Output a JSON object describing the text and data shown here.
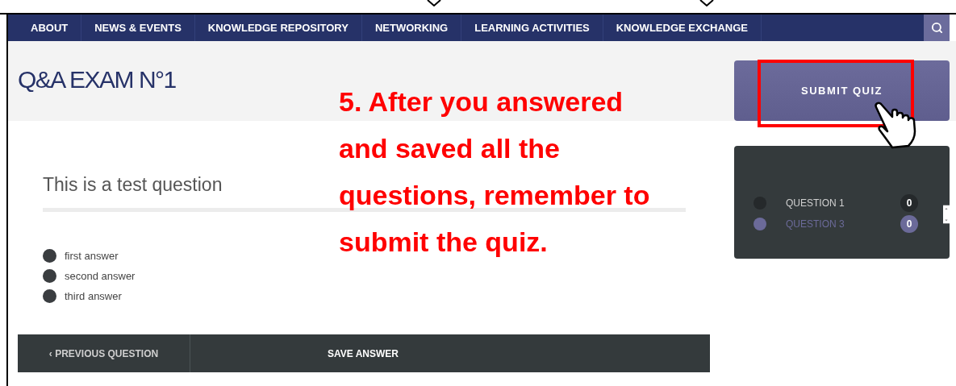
{
  "nav": {
    "items": [
      "ABOUT",
      "NEWS & EVENTS",
      "KNOWLEDGE REPOSITORY",
      "NETWORKING",
      "LEARNING ACTIVITIES",
      "KNOWLEDGE EXCHANGE"
    ]
  },
  "page_title": "Q&A EXAM N°1",
  "question": {
    "text": "This is a test question",
    "answers": [
      {
        "label": "first answer",
        "selected": false
      },
      {
        "label": "second answer",
        "selected": false
      },
      {
        "label": "third answer",
        "selected": false
      }
    ]
  },
  "actions": {
    "previous": "‹ PREVIOUS QUESTION",
    "save": "SAVE ANSWER"
  },
  "submit_button": "SUBMIT QUIZ",
  "question_list": [
    {
      "label": "QUESTION 1",
      "count": "0",
      "selected": false
    },
    {
      "label": "QUESTION 3",
      "count": "0",
      "selected": true
    }
  ],
  "annotation": {
    "lines": [
      "5. After you answered",
      "and saved all the",
      "questions, remember to",
      "submit the quiz."
    ]
  }
}
